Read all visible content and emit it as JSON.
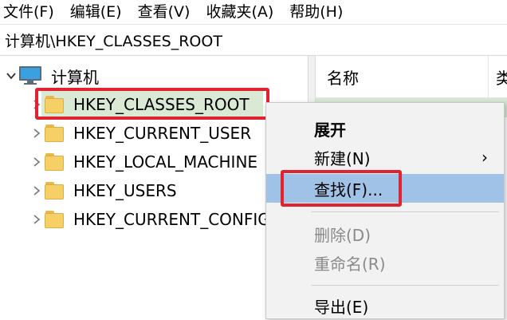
{
  "menubar": {
    "items": [
      {
        "label": "文件(F)"
      },
      {
        "label": "编辑(E)"
      },
      {
        "label": "查看(V)"
      },
      {
        "label": "收藏夹(A)"
      },
      {
        "label": "帮助(H)"
      }
    ]
  },
  "address": {
    "path": "计算机\\HKEY_CLASSES_ROOT"
  },
  "tree": {
    "root_label": "计算机",
    "root_icon": "computer-icon",
    "children": [
      {
        "label": "HKEY_CLASSES_ROOT",
        "selected": true
      },
      {
        "label": "HKEY_CURRENT_USER",
        "selected": false
      },
      {
        "label": "HKEY_LOCAL_MACHINE",
        "selected": false
      },
      {
        "label": "HKEY_USERS",
        "selected": false
      },
      {
        "label": "HKEY_CURRENT_CONFIG",
        "selected": false
      }
    ],
    "folder_icon": "folder-icon"
  },
  "list": {
    "column_name": "名称",
    "column_next": "类"
  },
  "context_menu": {
    "items": [
      {
        "label": "展开",
        "bold": true,
        "disabled": false
      },
      {
        "label": "新建(N)",
        "has_submenu": true,
        "disabled": false
      },
      {
        "label": "查找(F)...",
        "hovered": true,
        "disabled": false
      },
      {
        "label": "删除(D)",
        "disabled": true
      },
      {
        "label": "重命名(R)",
        "disabled": true
      },
      {
        "label": "导出(E)",
        "disabled": false
      }
    ],
    "submenu_arrow": "›"
  },
  "colors": {
    "selection": "#d9e9d4",
    "menu_hover": "#9fc2e6",
    "annotation": "#e02330"
  }
}
